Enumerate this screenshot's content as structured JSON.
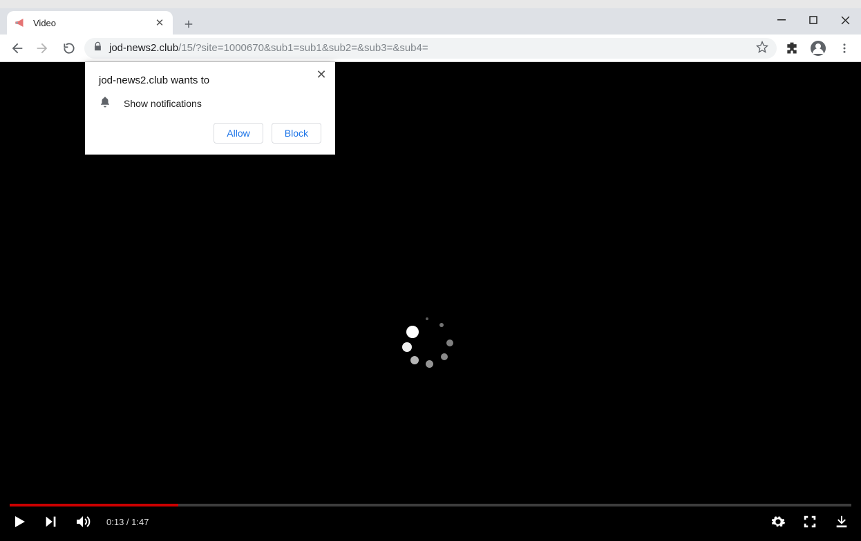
{
  "window": {
    "tab_title": "Video"
  },
  "url": {
    "domain": "jod-news2.club",
    "path": "/15/?site=1000670&sub1=sub1&sub2=&sub3=&sub4="
  },
  "permission": {
    "title": "jod-news2.club wants to",
    "item": "Show notifications",
    "allow": "Allow",
    "block": "Block"
  },
  "player": {
    "current": "0:13",
    "duration": "1:47",
    "separator": " / ",
    "progress_pct": 20
  }
}
